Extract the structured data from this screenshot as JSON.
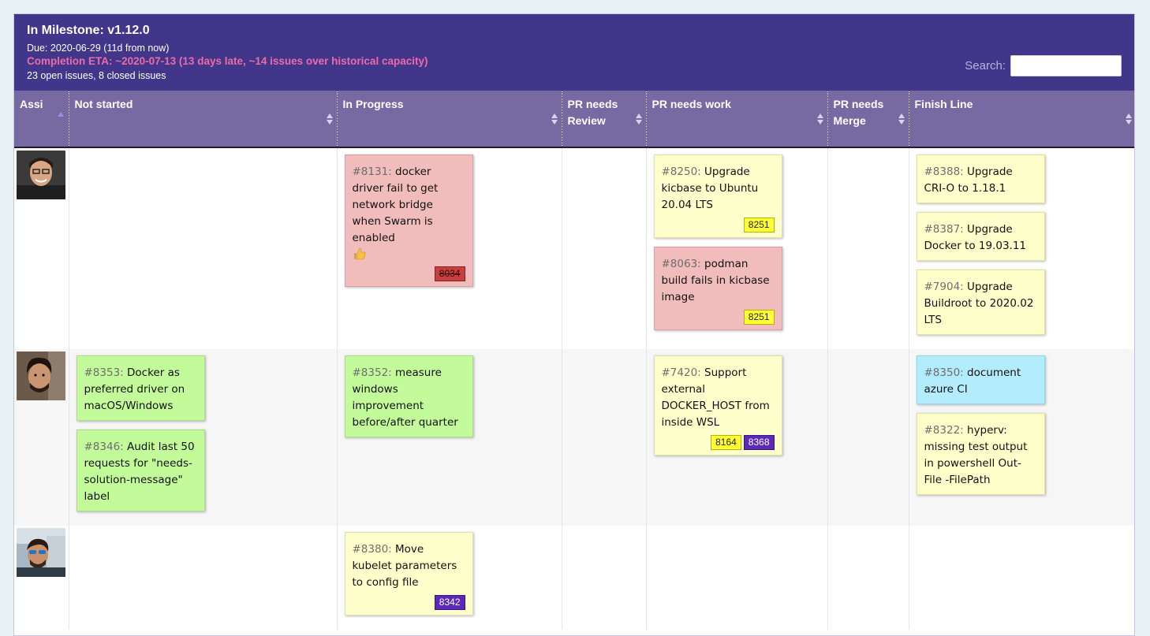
{
  "header": {
    "title": "In Milestone: v1.12.0",
    "due": "Due: 2020-06-29 (11d from now)",
    "eta": "Completion ETA: ~2020-07-13 (13 days late, ~14 issues over historical capacity)",
    "counts": "23 open issues, 8 closed issues",
    "search_label": "Search:",
    "search_value": ""
  },
  "columns": [
    {
      "label": "Assi"
    },
    {
      "label": "Not started"
    },
    {
      "label": "In Progress"
    },
    {
      "label": "PR needs Review"
    },
    {
      "label": "PR needs work"
    },
    {
      "label": "PR needs Merge"
    },
    {
      "label": "Finish Line"
    }
  ],
  "rows": [
    {
      "not_started": [],
      "in_progress": [
        {
          "num": "#8131:",
          "title": "docker driver fail to get network bridge when Swarm is enabled",
          "color": "red",
          "thumb": true,
          "prs": [
            {
              "label": "8034",
              "style": "red"
            }
          ]
        }
      ],
      "pr_review": [],
      "pr_work": [
        {
          "num": "#8250:",
          "title": "Upgrade kicbase to Ubuntu 20.04 LTS",
          "color": "yellow",
          "prs": [
            {
              "label": "8251",
              "style": "yellow"
            }
          ]
        },
        {
          "num": "#8063:",
          "title": "podman build fails in kicbase image",
          "color": "red",
          "prs": [
            {
              "label": "8251",
              "style": "yellow"
            }
          ]
        }
      ],
      "pr_merge": [],
      "finish": [
        {
          "num": "#8388:",
          "title": "Upgrade CRI-O to 1.18.1",
          "color": "yellow",
          "prs": []
        },
        {
          "num": "#8387:",
          "title": "Upgrade Docker to 19.03.11",
          "color": "yellow",
          "prs": []
        },
        {
          "num": "#7904:",
          "title": "Upgrade Buildroot to 2020.02 LTS",
          "color": "yellow",
          "prs": []
        }
      ]
    },
    {
      "not_started": [
        {
          "num": "#8353:",
          "title": "Docker as preferred driver on macOS/Windows",
          "color": "green",
          "prs": []
        },
        {
          "num": "#8346:",
          "title": "Audit last 50 requests for \"needs-solution-message\" label",
          "color": "green",
          "prs": []
        }
      ],
      "in_progress": [
        {
          "num": "#8352:",
          "title": "measure windows improvement before/after quarter",
          "color": "green",
          "prs": []
        }
      ],
      "pr_review": [],
      "pr_work": [
        {
          "num": "#7420:",
          "title": "Support external DOCKER_HOST from inside WSL",
          "color": "yellow",
          "prs": [
            {
              "label": "8164",
              "style": "yellow"
            },
            {
              "label": "8368",
              "style": "purple"
            }
          ]
        }
      ],
      "pr_merge": [],
      "finish": [
        {
          "num": "#8350:",
          "title": "document azure CI",
          "color": "blue",
          "prs": []
        },
        {
          "num": "#8322:",
          "title": "hyperv: missing test output in powershell Out-File -FilePath",
          "color": "yellow",
          "prs": []
        }
      ]
    },
    {
      "not_started": [],
      "in_progress": [
        {
          "num": "#8380:",
          "title": "Move kubelet parameters to config file",
          "color": "yellow",
          "prs": [
            {
              "label": "8342",
              "style": "purple"
            }
          ]
        }
      ],
      "pr_review": [],
      "pr_work": [],
      "pr_merge": [],
      "finish": []
    }
  ],
  "colors": {
    "header_bg": "#41368a",
    "column_header_bg": "#776aa3",
    "eta": "#ec6aa8"
  }
}
